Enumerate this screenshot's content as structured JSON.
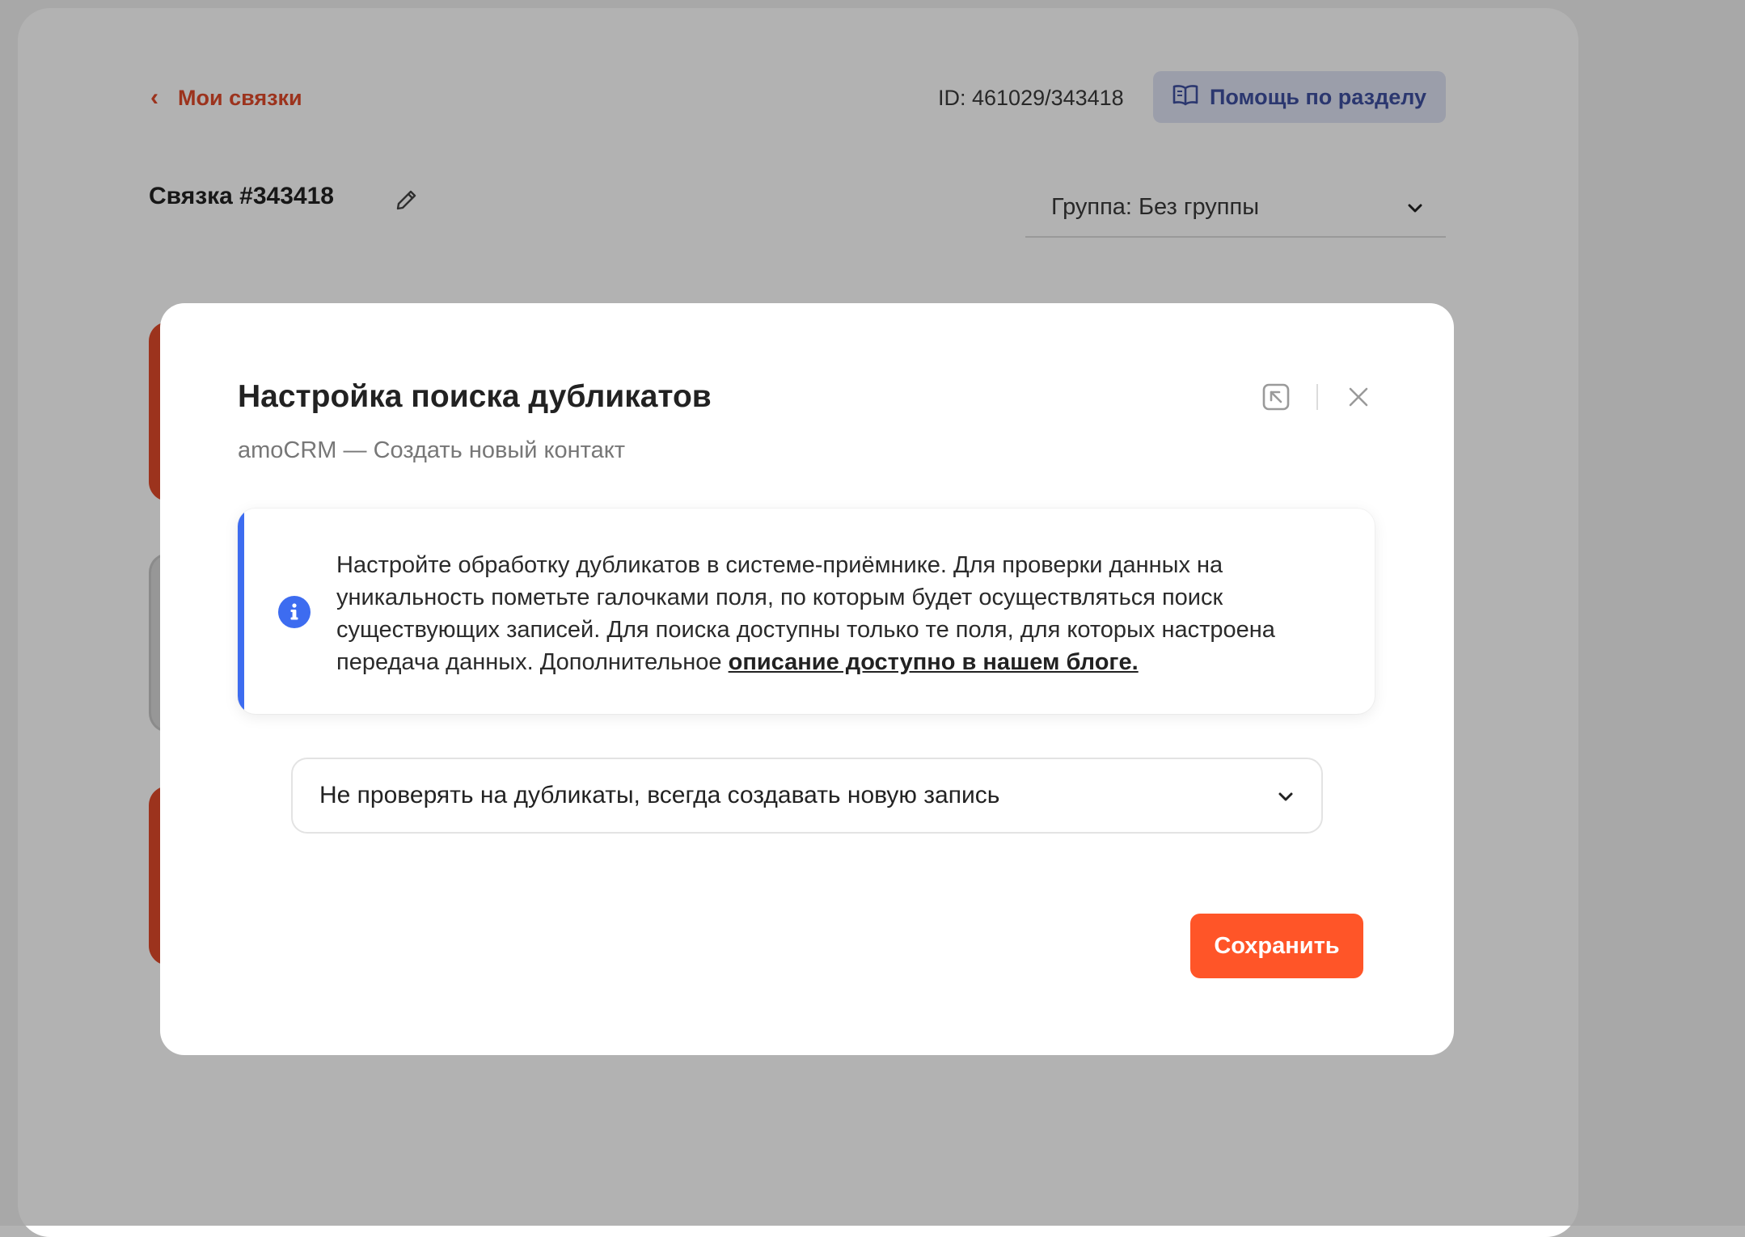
{
  "header": {
    "back_label": "Мои связки",
    "id_text": "ID: 461029/343418",
    "help_label": "Помощь по разделу"
  },
  "svyazka": {
    "title": "Связка #343418",
    "group_select": "Группа: Без группы"
  },
  "modal": {
    "title": "Настройка поиска дубликатов",
    "subtitle": "amoCRM — Создать новый контакт",
    "info": {
      "text": "Настройте обработку дубликатов в системе-приёмнике. Для проверки данных на уникальность пометьте галочками поля, по которым будет осуществляться поиск существующих записей. Для поиска доступны только те поля, для которых настроена передача данных. Дополнительное ",
      "link": "описание доступно в нашем блоге."
    },
    "duplicate_mode": {
      "selected": "Не проверять на дубликаты, всегда создавать новую запись"
    },
    "save_label": "Сохранить"
  },
  "colors": {
    "accent_orange": "#ff5528",
    "link_red": "#e0492a",
    "info_blue": "#3d6cf0",
    "help_bg": "#dfe3f4",
    "help_text": "#3e4fa0"
  },
  "icons": {
    "back": "chevron-left-icon",
    "help": "book-icon",
    "edit": "pencil-icon",
    "dropdown": "chevron-down-icon",
    "collapse": "collapse-arrow-icon",
    "close": "close-icon",
    "info": "info-icon"
  }
}
